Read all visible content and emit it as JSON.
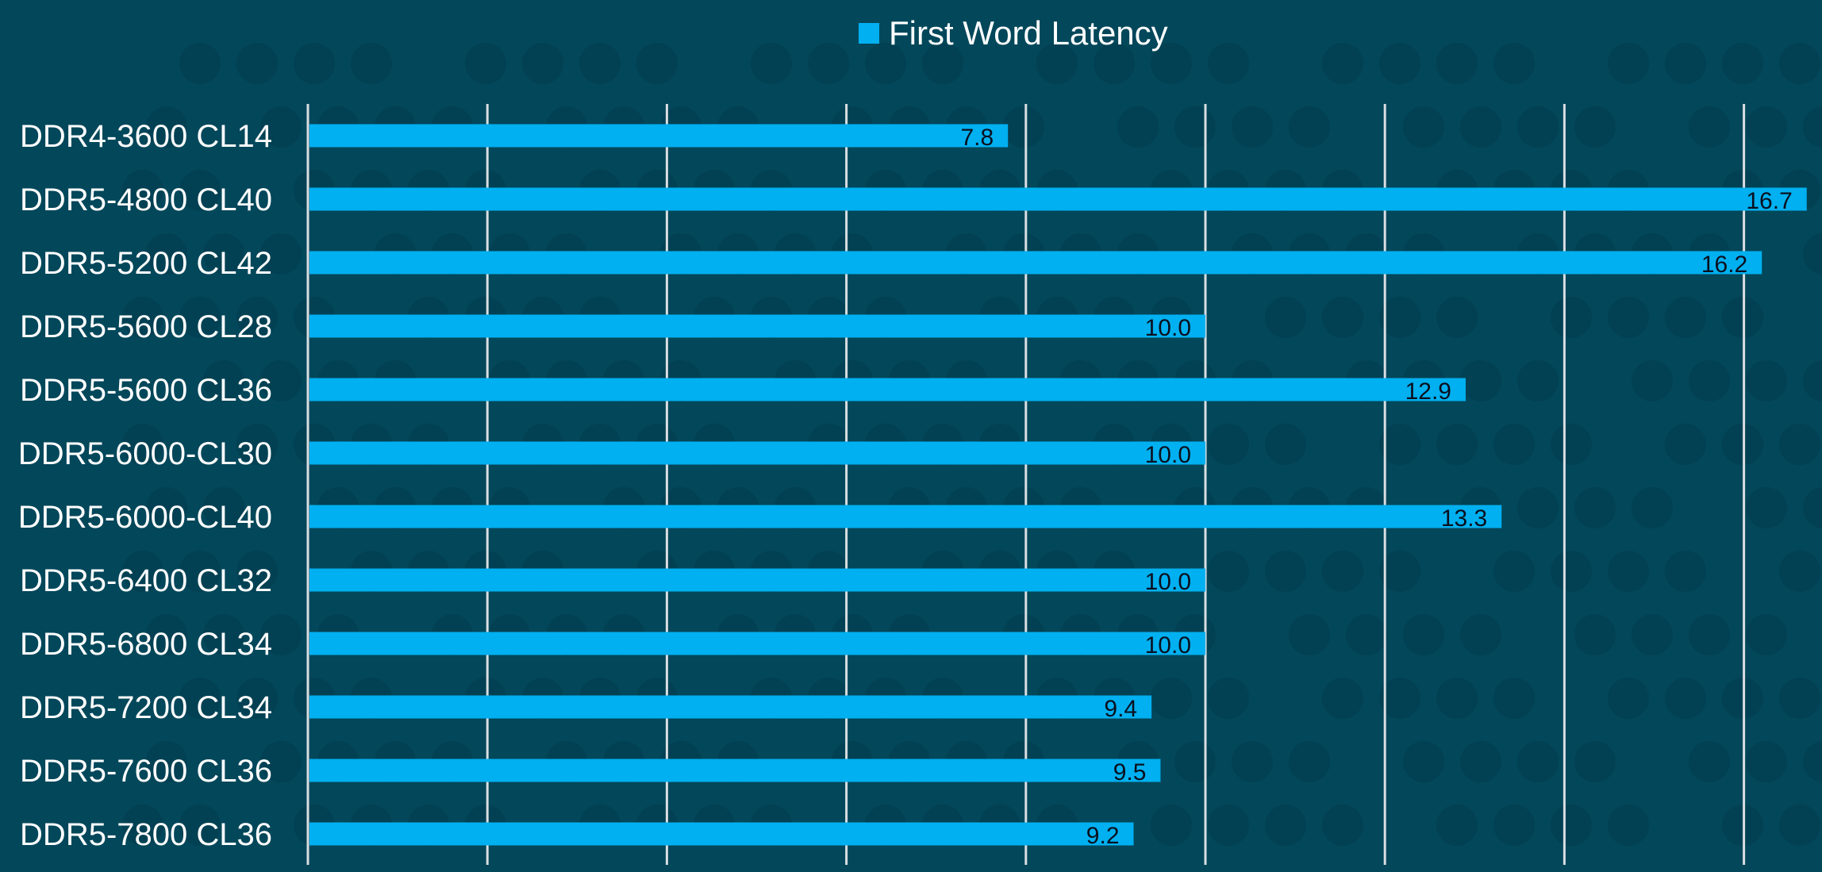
{
  "chart_data": {
    "type": "bar",
    "orientation": "horizontal",
    "title": "",
    "xlabel": "",
    "ylabel": "",
    "xlim": [
      0,
      17
    ],
    "x_gridline_step": 2,
    "x_tick_labels_visible": false,
    "grid": true,
    "legend": {
      "position": "top-center",
      "entries": [
        "First Word Latency"
      ]
    },
    "categories": [
      "DDR4-3600 CL14",
      "DDR5-4800 CL40",
      "DDR5-5200 CL42",
      "DDR5-5600 CL28",
      "DDR5-5600 CL36",
      "DDR5-6000-CL30",
      "DDR5-6000-CL40",
      "DDR5-6400 CL32",
      "DDR5-6800 CL34",
      "DDR5-7200 CL34",
      "DDR5-7600 CL36",
      "DDR5-7800 CL36"
    ],
    "series": [
      {
        "name": "First Word Latency",
        "color": "#00b0f0",
        "values": [
          7.8,
          16.7,
          16.2,
          10.0,
          12.9,
          10.0,
          13.3,
          10.0,
          10.0,
          9.4,
          9.5,
          9.2
        ],
        "data_labels": [
          "7.8",
          "16.7",
          "16.2",
          "10.0",
          "12.9",
          "10.0",
          "13.3",
          "10.0",
          "10.0",
          "9.4",
          "9.5",
          "9.2"
        ]
      }
    ]
  },
  "colors": {
    "background": "#03475a",
    "bar": "#00b0f0",
    "gridline": "#d9dee2",
    "category_text": "#ffffff",
    "value_text": "#0a0f1e"
  }
}
